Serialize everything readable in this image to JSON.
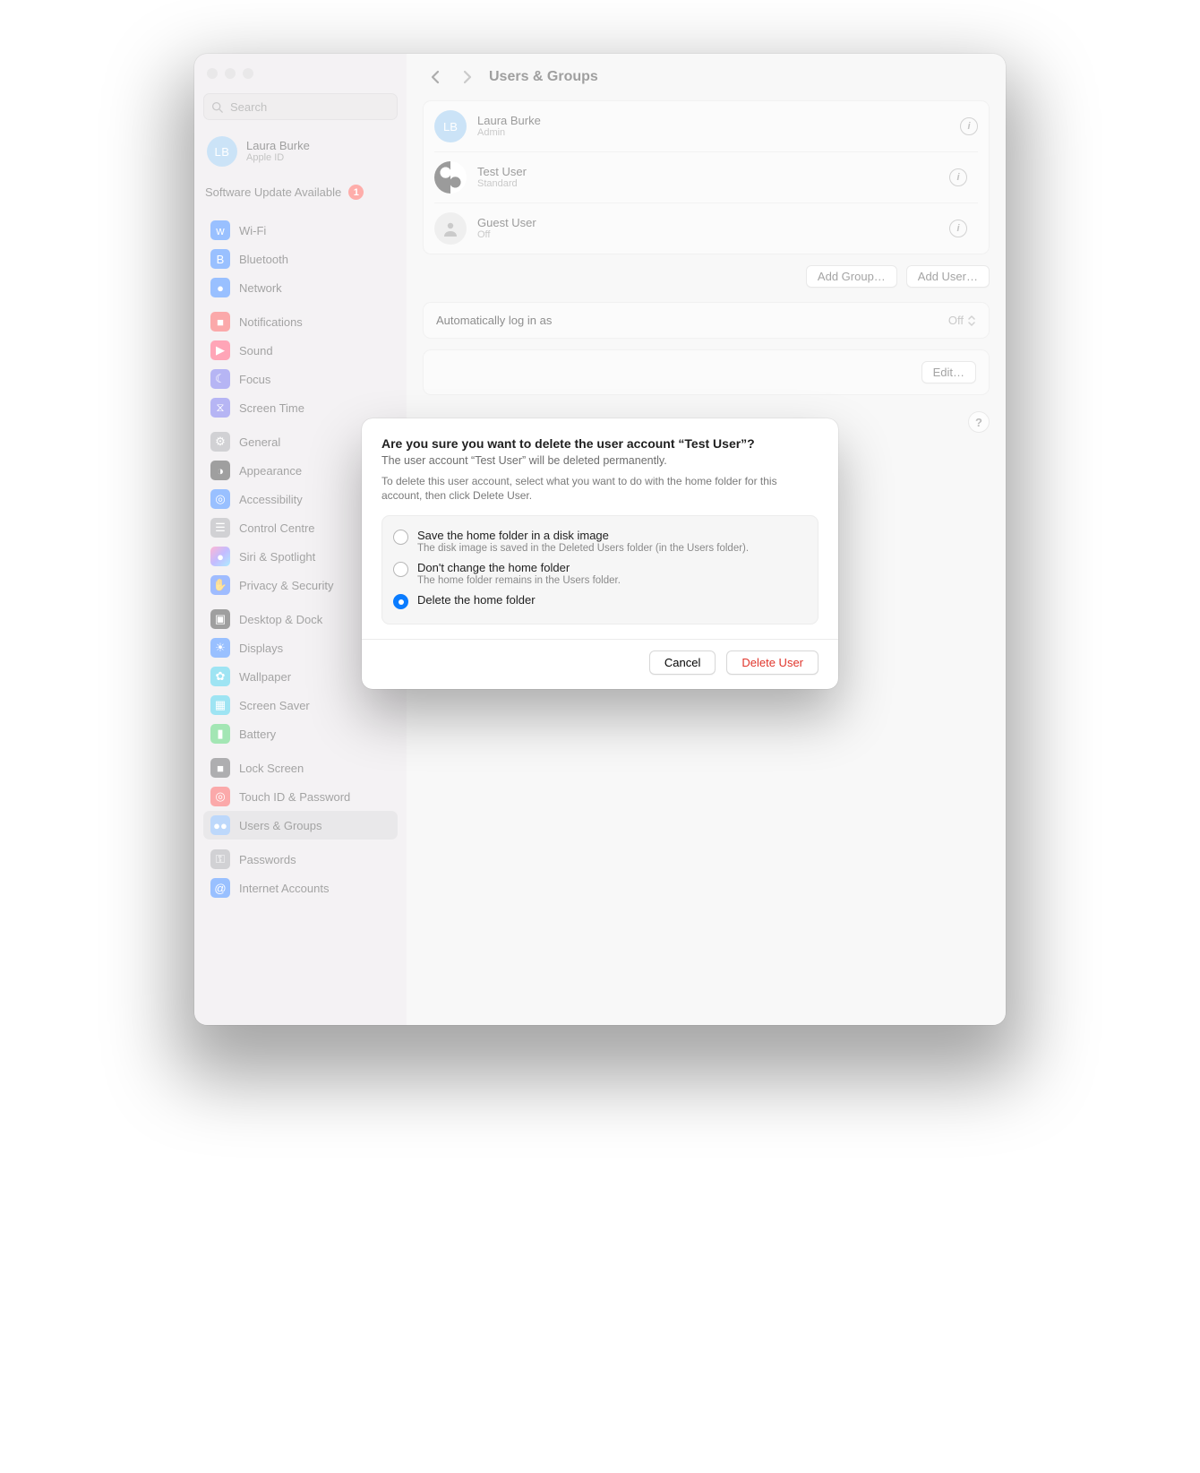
{
  "sidebar": {
    "search_placeholder": "Search",
    "account": {
      "initials": "LB",
      "name": "Laura Burke",
      "sub": "Apple ID"
    },
    "update": {
      "label": "Software Update Available",
      "count": "1"
    },
    "groups": [
      [
        {
          "label": "Wi-Fi",
          "icon": "wifi-icon",
          "bg": "bg-blue"
        },
        {
          "label": "Bluetooth",
          "icon": "bluetooth-icon",
          "bg": "bg-blue"
        },
        {
          "label": "Network",
          "icon": "network-icon",
          "bg": "bg-blue"
        }
      ],
      [
        {
          "label": "Notifications",
          "icon": "bell-icon",
          "bg": "bg-red"
        },
        {
          "label": "Sound",
          "icon": "sound-icon",
          "bg": "bg-pink"
        },
        {
          "label": "Focus",
          "icon": "focus-icon",
          "bg": "bg-indigo"
        },
        {
          "label": "Screen Time",
          "icon": "screentime-icon",
          "bg": "bg-indigo"
        }
      ],
      [
        {
          "label": "General",
          "icon": "general-icon",
          "bg": "bg-grey"
        },
        {
          "label": "Appearance",
          "icon": "appearance-icon",
          "bg": "bg-black"
        },
        {
          "label": "Accessibility",
          "icon": "accessibility-icon",
          "bg": "bg-blue"
        },
        {
          "label": "Control Centre",
          "icon": "controlcentre-icon",
          "bg": "bg-grey"
        },
        {
          "label": "Siri & Spotlight",
          "icon": "siri-icon",
          "bg": "bg-rainbow"
        },
        {
          "label": "Privacy & Security",
          "icon": "privacy-icon",
          "bg": "bg-hand"
        }
      ],
      [
        {
          "label": "Desktop & Dock",
          "icon": "desktop-icon",
          "bg": "bg-black"
        },
        {
          "label": "Displays",
          "icon": "displays-icon",
          "bg": "bg-blue"
        },
        {
          "label": "Wallpaper",
          "icon": "wallpaper-icon",
          "bg": "bg-teal"
        },
        {
          "label": "Screen Saver",
          "icon": "screensaver-icon",
          "bg": "bg-teal"
        },
        {
          "label": "Battery",
          "icon": "battery-icon",
          "bg": "bg-green"
        }
      ],
      [
        {
          "label": "Lock Screen",
          "icon": "lock-icon",
          "bg": "bg-dark"
        },
        {
          "label": "Touch ID & Password",
          "icon": "touchid-icon",
          "bg": "bg-red"
        },
        {
          "label": "Users & Groups",
          "icon": "users-icon",
          "bg": "bg-lblue",
          "active": true
        }
      ],
      [
        {
          "label": "Passwords",
          "icon": "key-icon",
          "bg": "bg-grey"
        },
        {
          "label": "Internet Accounts",
          "icon": "at-icon",
          "bg": "bg-blue"
        }
      ]
    ]
  },
  "main": {
    "title": "Users & Groups",
    "users": [
      {
        "initials": "LB",
        "name": "Laura Burke",
        "role": "Admin",
        "avatar": "initials"
      },
      {
        "initials": "",
        "name": "Test User",
        "role": "Standard",
        "avatar": "yy"
      },
      {
        "initials": "",
        "name": "Guest User",
        "role": "Off",
        "avatar": "guest"
      }
    ],
    "add_group": "Add Group…",
    "add_user": "Add User…",
    "auto_login_label": "Automatically log in as",
    "auto_login_value": "Off",
    "edit": "Edit…",
    "help": "?"
  },
  "modal": {
    "title": "Are you sure you want to delete the user account “Test User”?",
    "subtitle": "The user account “Test User” will be deleted permanently.",
    "desc": "To delete this user account, select what you want to do with the home folder for this account, then click Delete User.",
    "options": [
      {
        "label": "Save the home folder in a disk image",
        "sub": "The disk image is saved in the Deleted Users folder (in the Users folder).",
        "selected": false
      },
      {
        "label": "Don't change the home folder",
        "sub": "The home folder remains in the Users folder.",
        "selected": false
      },
      {
        "label": "Delete the home folder",
        "sub": "",
        "selected": true
      }
    ],
    "cancel": "Cancel",
    "delete": "Delete User"
  }
}
